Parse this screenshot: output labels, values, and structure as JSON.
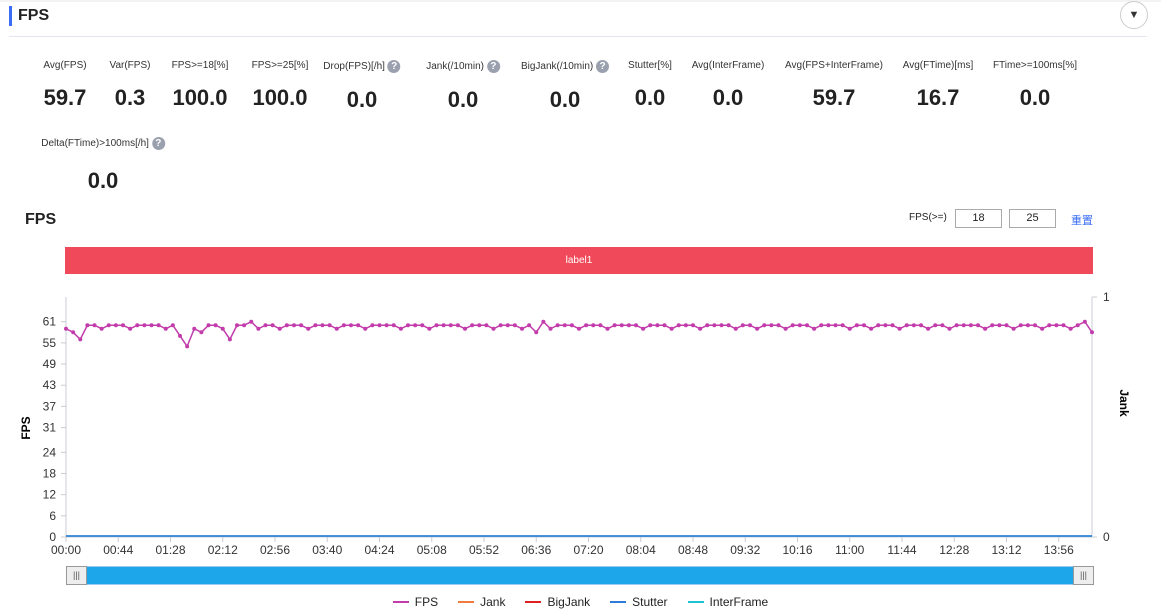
{
  "header": {
    "title": "FPS"
  },
  "metrics": [
    {
      "label": "Avg(FPS)",
      "value": "59.7",
      "help": false
    },
    {
      "label": "Var(FPS)",
      "value": "0.3",
      "help": false
    },
    {
      "label": "FPS>=18[%]",
      "value": "100.0",
      "help": false
    },
    {
      "label": "FPS>=25[%]",
      "value": "100.0",
      "help": false
    },
    {
      "label": "Drop(FPS)[/h]",
      "value": "0.0",
      "help": true
    },
    {
      "label": "Jank(/10min)",
      "value": "0.0",
      "help": true
    },
    {
      "label": "BigJank(/10min)",
      "value": "0.0",
      "help": true
    },
    {
      "label": "Stutter[%]",
      "value": "0.0",
      "help": false
    },
    {
      "label": "Avg(InterFrame)",
      "value": "0.0",
      "help": false
    },
    {
      "label": "Avg(FPS+InterFrame)",
      "value": "59.7",
      "help": false
    },
    {
      "label": "Avg(FTime)[ms]",
      "value": "16.7",
      "help": false
    },
    {
      "label": "FTime>=100ms[%]",
      "value": "0.0",
      "help": false
    },
    {
      "label": "Delta(FTime)>100ms[/h]",
      "value": "0.0",
      "help": true
    }
  ],
  "chart_controls": {
    "title": "FPS",
    "threshold_label": "FPS(>=)",
    "threshold1": "18",
    "threshold2": "25",
    "reset_label": "重置"
  },
  "label_band": "label1",
  "chart_data": {
    "type": "line",
    "ylabel": "FPS",
    "y2label": "Jank",
    "yticks": [
      0,
      6,
      12,
      18,
      24,
      31,
      37,
      43,
      49,
      55,
      61
    ],
    "ylim": [
      0,
      68
    ],
    "y2ticks": [
      0,
      1
    ],
    "xticks": [
      "00:00",
      "00:44",
      "01:28",
      "02:12",
      "02:56",
      "03:40",
      "04:24",
      "05:08",
      "05:52",
      "06:36",
      "07:20",
      "08:04",
      "08:48",
      "09:32",
      "10:16",
      "11:00",
      "11:44",
      "12:28",
      "13:12",
      "13:56"
    ],
    "x_range_seconds": [
      0,
      864
    ],
    "series": [
      {
        "name": "FPS",
        "color": "#c23cab",
        "step_seconds": 6,
        "values": [
          59,
          58,
          56,
          60,
          60,
          59,
          60,
          60,
          60,
          59,
          60,
          60,
          60,
          60,
          59,
          60,
          57,
          54,
          59,
          58,
          60,
          60,
          59,
          56,
          60,
          60,
          61,
          59,
          60,
          60,
          59,
          60,
          60,
          60,
          59,
          60,
          60,
          60,
          59,
          60,
          60,
          60,
          59,
          60,
          60,
          60,
          60,
          59,
          60,
          60,
          60,
          59,
          60,
          60,
          60,
          60,
          59,
          60,
          60,
          60,
          59,
          60,
          60,
          60,
          59,
          60,
          58,
          61,
          59,
          60,
          60,
          60,
          59,
          60,
          60,
          60,
          59,
          60,
          60,
          60,
          60,
          59,
          60,
          60,
          60,
          59,
          60,
          60,
          60,
          59,
          60,
          60,
          60,
          60,
          59,
          60,
          60,
          59,
          60,
          60,
          60,
          59,
          60,
          60,
          60,
          59,
          60,
          60,
          60,
          60,
          59,
          60,
          60,
          59,
          60,
          60,
          60,
          59,
          60,
          60,
          60,
          59,
          60,
          60,
          59,
          60,
          60,
          60,
          60,
          59,
          60,
          60,
          60,
          59,
          60,
          60,
          60,
          59,
          60,
          60,
          60,
          59,
          60,
          61,
          58
        ]
      },
      {
        "name": "Jank",
        "color": "#f07b3f",
        "values": []
      },
      {
        "name": "BigJank",
        "color": "#e02020",
        "values": []
      },
      {
        "name": "Stutter",
        "color": "#2f7ad8",
        "values": []
      },
      {
        "name": "InterFrame",
        "color": "#1fc2d3",
        "values": []
      }
    ]
  }
}
